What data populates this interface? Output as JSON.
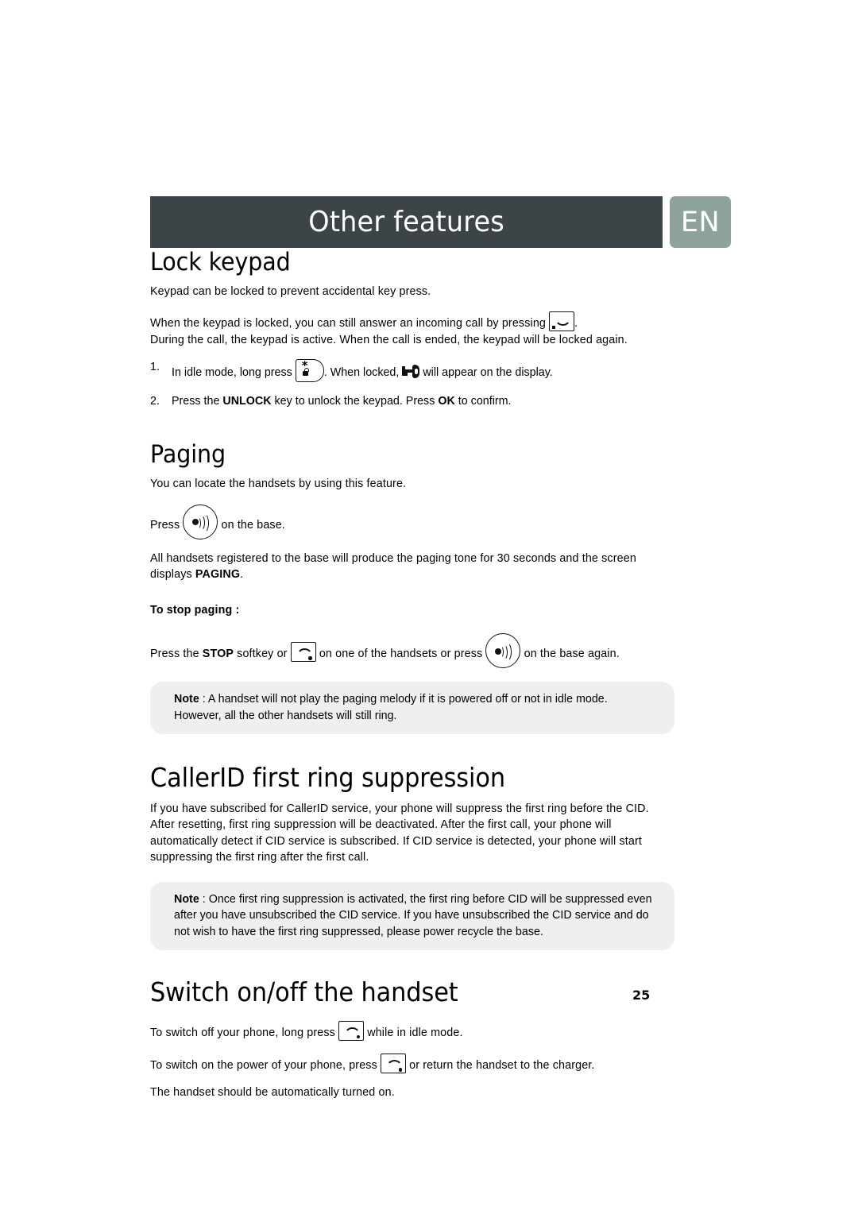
{
  "header": {
    "title": "Other features",
    "language_tab": "EN"
  },
  "sections": {
    "lock_keypad": {
      "heading": "Lock keypad",
      "intro": "Keypad can be locked to prevent accidental key press.",
      "para_line1_before": "When the keypad is locked, you can still answer an incoming call by pressing",
      "para_line1_after": ".",
      "para_line2": "During the call, the keypad is active. When the call is ended, the keypad will be locked again.",
      "steps": [
        {
          "num": "1.",
          "before": "In idle mode, long press",
          "middle": ". When locked,",
          "after": "will appear on the display."
        },
        {
          "num": "2.",
          "text_1": "Press the ",
          "bold_1": "UNLOCK",
          "text_2": " key to unlock the keypad. Press ",
          "bold_2": "OK",
          "text_3": " to confirm."
        }
      ]
    },
    "paging": {
      "heading": "Paging",
      "intro": "You can locate the handsets by using this feature.",
      "press_before": "Press",
      "press_after": "on the base.",
      "description_line1": "All handsets registered to the base will produce the paging tone for 30 seconds and the screen displays",
      "description_bold": "PAGING",
      "description_end": ".",
      "stop_label": "To stop paging :",
      "stop_text_1": "Press the ",
      "stop_bold": "STOP",
      "stop_text_2": " softkey or",
      "stop_text_3": "on one of the handsets or press",
      "stop_text_4": "on the base again.",
      "note": {
        "label": "Note",
        "separator": " : ",
        "text": "A handset will not play the paging melody if it is powered off or not in idle mode. However, all the other handsets will still ring."
      }
    },
    "callerid": {
      "heading": "CallerID first ring suppression",
      "body": "If you have subscribed for CallerID service, your phone will suppress the first ring before the CID. After resetting, first ring suppression will be deactivated. After the first call,  your phone will automatically detect if CID service is subscribed. If CID service is detected, your phone will start suppressing the first ring after the first call.",
      "note": {
        "label": "Note",
        "separator": " : ",
        "text": "Once first ring suppression is activated, the first ring before CID will be suppressed even after you have unsubscribed the CID service. If you have unsubscribed the CID service and do not wish to have the first ring suppressed, please power recycle the base."
      }
    },
    "switch_onoff": {
      "heading": "Switch on/off the handset",
      "line1_before": "To switch off your phone, long press",
      "line1_after": "while in idle mode.",
      "line2_before": "To switch on the power of your phone, press",
      "line2_after": "or return the handset to the charger.",
      "line3": "The handset should be automatically turned on."
    }
  },
  "footer": {
    "page_number": "25"
  },
  "colors": {
    "header_bar": "#3c4447",
    "lang_tab": "#8fa39d",
    "note_bg": "#eef0ef",
    "text": "#000000"
  }
}
